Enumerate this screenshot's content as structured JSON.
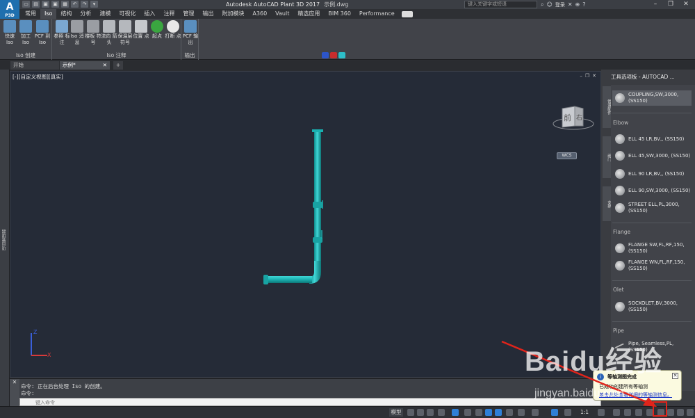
{
  "app": {
    "logo": "A",
    "logo_sub": "P3D"
  },
  "title": {
    "app_name": "Autodesk AutoCAD Plant 3D 2017",
    "file_name": "示例.dwg"
  },
  "search": {
    "placeholder": "键入关键字或短语"
  },
  "account": {
    "login": "登录"
  },
  "ribbon_tabs": [
    "常用",
    "Iso",
    "结构",
    "分析",
    "建模",
    "可视化",
    "插入",
    "注释",
    "管理",
    "输出",
    "附加模块",
    "A360",
    "Vault",
    "精选应用",
    "BIM 360",
    "Performance"
  ],
  "ribbon": {
    "create": {
      "label": "Iso 创建",
      "buttons": [
        "快速 Iso",
        "加工 Iso",
        "PCF 到 Iso"
      ]
    },
    "annotate": {
      "label": "Iso 注释",
      "buttons": [
        "参照 标注",
        "Iso 消息",
        "楼板 符号",
        "流向 箭头",
        "保温层 符号",
        "位置 点",
        "起点",
        "打断 点"
      ]
    },
    "output": {
      "label": "输出",
      "buttons": [
        "PCF 输出"
      ]
    }
  },
  "file_tabs": {
    "start": "开始",
    "example": "示例*",
    "add": "+"
  },
  "viewport": {
    "label": "[-][自定义视图][真实]",
    "cube_front": "前",
    "cube_right": "右",
    "wcs": "WCS"
  },
  "palette": {
    "title": "工具选项板 - AUTOCAD ...",
    "sections": {
      "elbow": "Elbow",
      "flange": "Flange",
      "olet": "Olet",
      "pipe": "Pipe"
    },
    "items": {
      "coupling": "COUPLING,SW,3000, (SS150)",
      "ell45lr": "ELL 45 LR,BV,, (SS150)",
      "ell45sw": "ELL 45,SW,3000, (SS150)",
      "ell90lr": "ELL 90 LR,BV,, (SS150)",
      "ell90sw": "ELL 90,SW,3000, (SS150)",
      "street": "STREET ELL,PL,3000, (SS150)",
      "flange_sw": "FLANGE SW,FL,RF,150, (SS150)",
      "flange_wn": "FLANGE WN,FL,RF,150, (SS150)",
      "sockolet": "SOCKOLET,BV,3000, (SS150)",
      "pipe": "Pipe, Seamless,PL, (SS150)"
    }
  },
  "command": {
    "line1": "命令: 正在后台处理 Iso 的创建。",
    "line2": "命令:",
    "placeholder": "键入命令"
  },
  "statusbar": {
    "model": "模型",
    "scale": "1:1"
  },
  "balloon": {
    "title": "等轴测图完成",
    "message": "已成功创建所有等轴测",
    "link": "单击此处查看详细的等轴测信息。"
  },
  "watermark": {
    "text": "Baidu经验",
    "url": "jingyan.baidu.com"
  },
  "colors": {
    "pipe": "#1ab0b0",
    "accent": "#1f6fae",
    "arrow": "#e0241b"
  }
}
